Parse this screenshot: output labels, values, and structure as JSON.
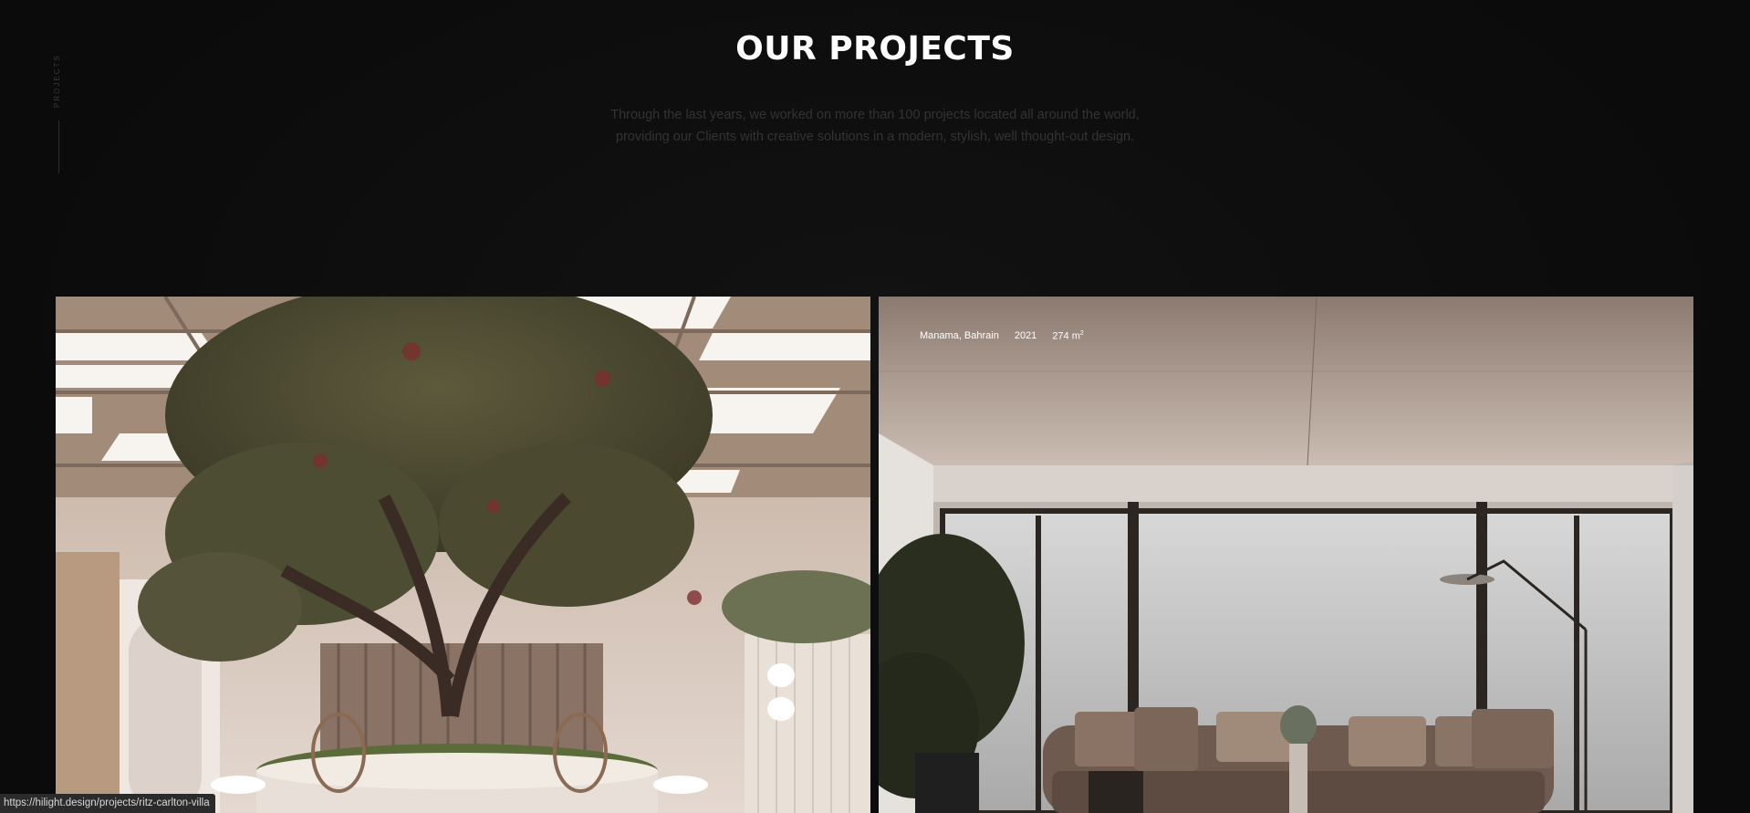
{
  "section": {
    "side_label": "PROJECTS",
    "title": "OUR PROJECTS",
    "intro": "Through the last years, we worked on more than 100 projects located all around the world, providing our Clients with creative solutions in a modern, stylish, well thought-out design."
  },
  "projects": [
    {
      "image_icon": "interior-tree-atrium-image"
    },
    {
      "image_icon": "living-room-sofa-image",
      "location": "Manama, Bahrain",
      "year": "2021",
      "area": "274 m",
      "area_unit_sup": "2"
    }
  ],
  "status_bar": {
    "url": "https://hilight.design/projects/ritz-carlton-villa"
  },
  "colors": {
    "background": "#0c0c0c",
    "title": "#ffffff",
    "intro_text": "#333333"
  }
}
